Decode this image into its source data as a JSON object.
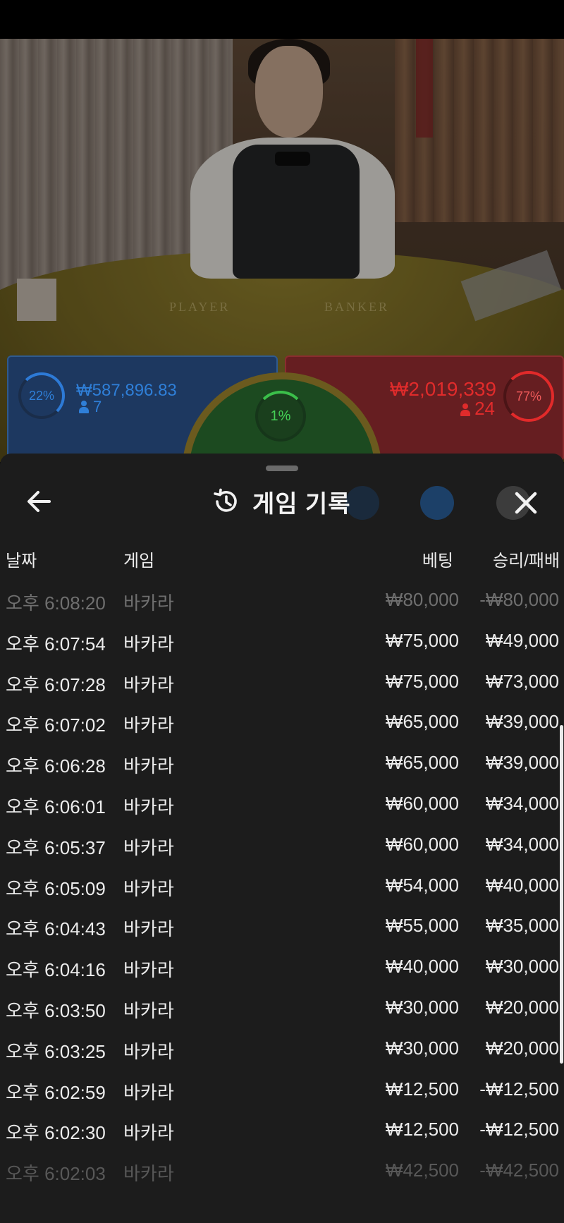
{
  "overlay": {
    "table_labels": {
      "player": "PLAYER",
      "banker": "BANKER"
    },
    "player": {
      "percent": "22%",
      "amount": "₩587,896.83",
      "count": "7",
      "color": "#2f7fd8"
    },
    "tie": {
      "percent": "1%",
      "color": "#45d156"
    },
    "banker": {
      "percent": "77%",
      "amount": "₩2,019,339",
      "count": "24",
      "color": "#e02b2b"
    }
  },
  "history": {
    "title": "게임 기록",
    "icons": {
      "back": "arrow-left-icon",
      "history": "history-clock-icon",
      "close": "close-x-icon"
    },
    "columns": {
      "date": "날짜",
      "game": "게임",
      "bet": "베팅",
      "result": "승리/패배"
    },
    "rows": [
      {
        "time": "오후 6:08:20",
        "game": "바카라",
        "bet": "₩80,000",
        "result": "-₩80,000"
      },
      {
        "time": "오후 6:07:54",
        "game": "바카라",
        "bet": "₩75,000",
        "result": "₩49,000"
      },
      {
        "time": "오후 6:07:28",
        "game": "바카라",
        "bet": "₩75,000",
        "result": "₩73,000"
      },
      {
        "time": "오후 6:07:02",
        "game": "바카라",
        "bet": "₩65,000",
        "result": "₩39,000"
      },
      {
        "time": "오후 6:06:28",
        "game": "바카라",
        "bet": "₩65,000",
        "result": "₩39,000"
      },
      {
        "time": "오후 6:06:01",
        "game": "바카라",
        "bet": "₩60,000",
        "result": "₩34,000"
      },
      {
        "time": "오후 6:05:37",
        "game": "바카라",
        "bet": "₩60,000",
        "result": "₩34,000"
      },
      {
        "time": "오후 6:05:09",
        "game": "바카라",
        "bet": "₩54,000",
        "result": "₩40,000"
      },
      {
        "time": "오후 6:04:43",
        "game": "바카라",
        "bet": "₩55,000",
        "result": "₩35,000"
      },
      {
        "time": "오후 6:04:16",
        "game": "바카라",
        "bet": "₩40,000",
        "result": "₩30,000"
      },
      {
        "time": "오후 6:03:50",
        "game": "바카라",
        "bet": "₩30,000",
        "result": "₩20,000"
      },
      {
        "time": "오후 6:03:25",
        "game": "바카라",
        "bet": "₩30,000",
        "result": "₩20,000"
      },
      {
        "time": "오후 6:02:59",
        "game": "바카라",
        "bet": "₩12,500",
        "result": "-₩12,500"
      },
      {
        "time": "오후 6:02:30",
        "game": "바카라",
        "bet": "₩12,500",
        "result": "-₩12,500"
      },
      {
        "time": "오후 6:02:03",
        "game": "바카라",
        "bet": "₩42,500",
        "result": "-₩42,500"
      }
    ]
  }
}
